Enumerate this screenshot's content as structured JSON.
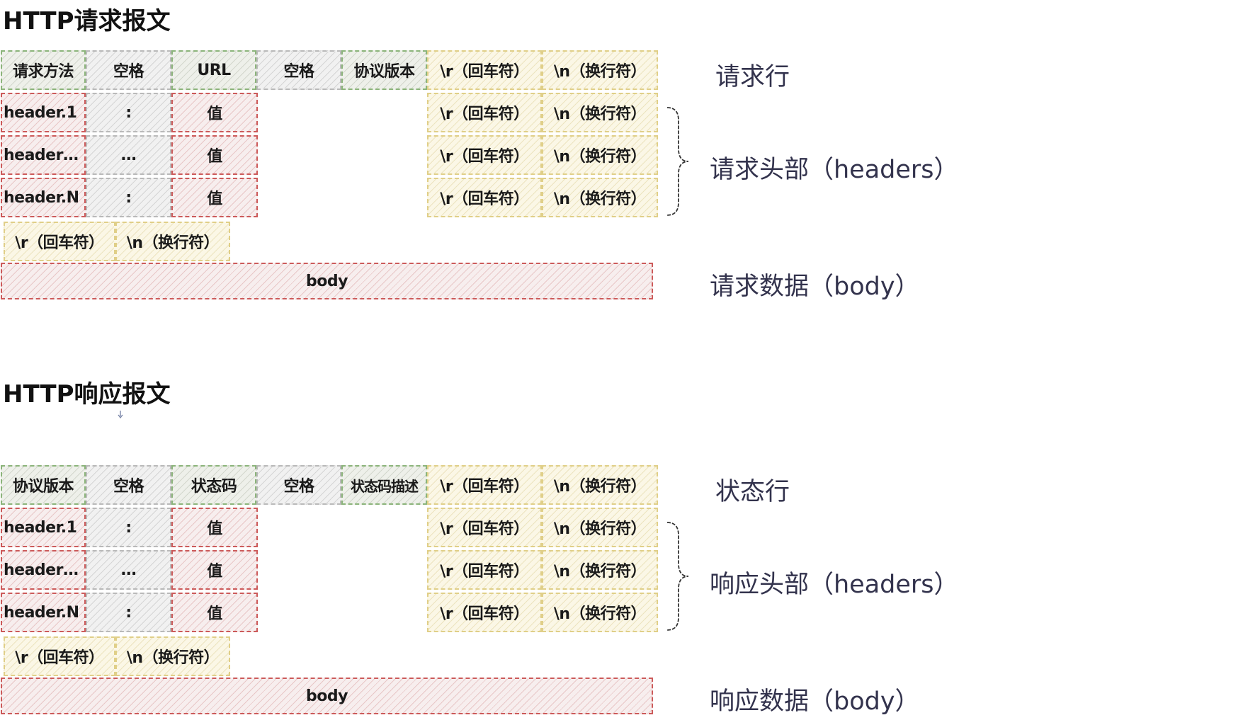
{
  "request": {
    "title": "HTTP请求报文",
    "line": [
      "请求方法",
      "空格",
      "URL",
      "空格",
      "协议版本",
      "\\r（回车符）",
      "\\n（换行符）"
    ],
    "line_label": "请求行",
    "headers": [
      [
        "header.1",
        ":",
        "值",
        "\\r（回车符）",
        "\\n（换行符）"
      ],
      [
        "header…",
        "…",
        "值",
        "\\r（回车符）",
        "\\n（换行符）"
      ],
      [
        "header.N",
        ":",
        "值",
        "\\r（回车符）",
        "\\n（换行符）"
      ]
    ],
    "headers_label": "请求头部（headers）",
    "blank": [
      "\\r（回车符）",
      "\\n（换行符）"
    ],
    "body": "body",
    "body_label": "请求数据（body）"
  },
  "response": {
    "title": "HTTP响应报文",
    "line": [
      "协议版本",
      "空格",
      "状态码",
      "空格",
      "状态码描述",
      "\\r（回车符）",
      "\\n（换行符）"
    ],
    "line_label": "状态行",
    "headers": [
      [
        "header.1",
        ":",
        "值",
        "\\r（回车符）",
        "\\n（换行符）"
      ],
      [
        "header…",
        "…",
        "值",
        "\\r（回车符）",
        "\\n（换行符）"
      ],
      [
        "header.N",
        ":",
        "值",
        "\\r（回车符）",
        "\\n（换行符）"
      ]
    ],
    "headers_label": "响应头部（headers）",
    "blank": [
      "\\r（回车符）",
      "\\n（换行符）"
    ],
    "body": "body",
    "body_label": "响应数据（body）"
  }
}
